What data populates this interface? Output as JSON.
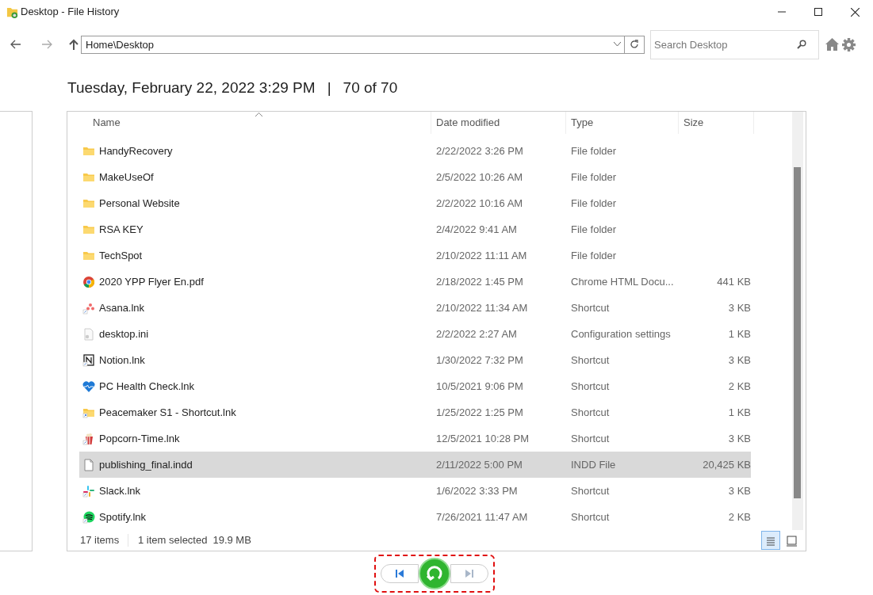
{
  "window": {
    "title": "Desktop - File History"
  },
  "address": {
    "value": "Home\\Desktop"
  },
  "search": {
    "placeholder": "Search Desktop"
  },
  "heading": {
    "date": "Tuesday, February 22, 2022 3:29 PM",
    "separator": "|",
    "position": "70 of 70"
  },
  "table": {
    "columns": [
      "Name",
      "Date modified",
      "Type",
      "Size"
    ],
    "rows": [
      {
        "kind": "folder",
        "name": "HandyRecovery",
        "date": "2/22/2022 3:26 PM",
        "type": "File folder",
        "selected": false
      },
      {
        "kind": "folder",
        "name": "MakeUseOf",
        "date": "2/5/2022 10:26 AM",
        "type": "File folder",
        "selected": false
      },
      {
        "kind": "folder",
        "name": "Personal Website",
        "date": "2/2/2022 10:16 AM",
        "type": "File folder",
        "selected": false
      },
      {
        "kind": "folder",
        "name": "RSA KEY",
        "date": "2/4/2022 9:41 AM",
        "type": "File folder",
        "selected": false
      },
      {
        "kind": "folder",
        "name": "TechSpot",
        "date": "2/10/2022 11:11 AM",
        "type": "File folder",
        "selected": false
      },
      {
        "kind": "chrome",
        "name": "2020 YPP Flyer En.pdf",
        "date": "2/18/2022 1:45 PM",
        "type": "Chrome HTML Docu...",
        "size": "441 KB",
        "selected": false
      },
      {
        "kind": "asana",
        "name": "Asana.lnk",
        "date": "2/10/2022 11:34 AM",
        "type": "Shortcut",
        "size": "3 KB",
        "selected": false
      },
      {
        "kind": "settings-file",
        "name": "desktop.ini",
        "date": "2/2/2022 2:27 AM",
        "type": "Configuration settings",
        "size": "1 KB",
        "selected": false
      },
      {
        "kind": "notion",
        "name": "Notion.lnk",
        "date": "1/30/2022 7:32 PM",
        "type": "Shortcut",
        "size": "3 KB",
        "selected": false
      },
      {
        "kind": "heart",
        "name": "PC Health Check.lnk",
        "date": "10/5/2021 9:06 PM",
        "type": "Shortcut",
        "size": "2 KB",
        "selected": false
      },
      {
        "kind": "folder-shortcut",
        "name": "Peacemaker S1 - Shortcut.lnk",
        "date": "1/25/2022 1:25 PM",
        "type": "Shortcut",
        "size": "1 KB",
        "selected": false
      },
      {
        "kind": "popcorn",
        "name": "Popcorn-Time.lnk",
        "date": "12/5/2021 10:28 PM",
        "type": "Shortcut",
        "size": "3 KB",
        "selected": false
      },
      {
        "kind": "file",
        "name": "publishing_final.indd",
        "date": "2/11/2022 5:00 PM",
        "type": "INDD File",
        "size": "20,425 KB",
        "selected": true
      },
      {
        "kind": "slack",
        "name": "Slack.lnk",
        "date": "1/6/2022 3:33 PM",
        "type": "Shortcut",
        "size": "3 KB",
        "selected": false
      },
      {
        "kind": "spotify",
        "name": "Spotify.lnk",
        "date": "7/26/2021 11:47 AM",
        "type": "Shortcut",
        "size": "2 KB",
        "selected": false
      }
    ]
  },
  "status_bar": {
    "count": "17 items",
    "selection": "1 item selected",
    "size": "19.9 MB"
  },
  "view_modes": [
    {
      "kind": "details",
      "selected": true
    },
    {
      "kind": "tiles",
      "selected": false
    }
  ],
  "playback": [
    {
      "kind": "previous",
      "disabled": false
    },
    {
      "kind": "restore"
    },
    {
      "kind": "next",
      "disabled": true
    }
  ]
}
